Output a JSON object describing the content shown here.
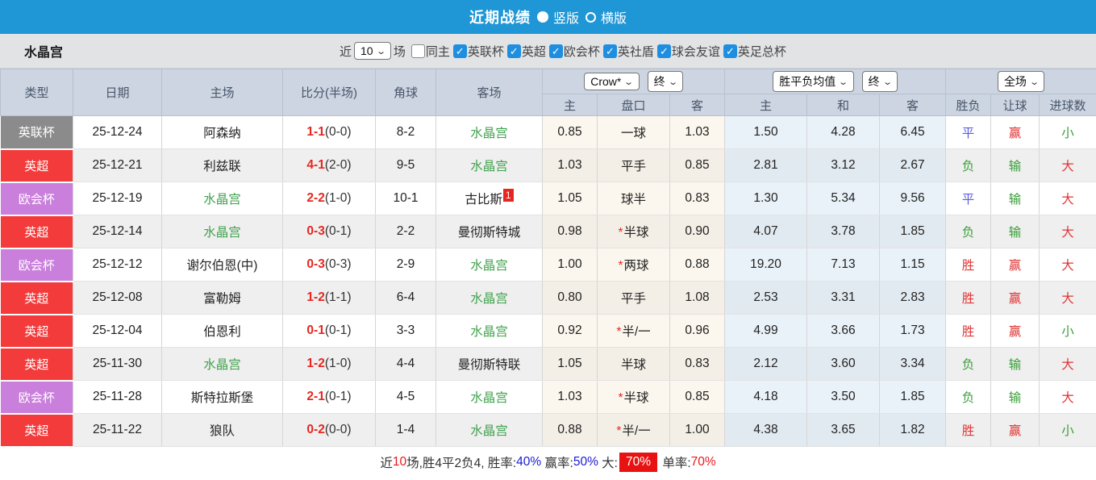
{
  "topbar": {
    "title": "近期战绩",
    "radio_vertical": "竖版",
    "radio_horizontal": "横版"
  },
  "filter": {
    "team": "水晶宫",
    "recent_label": "近",
    "recent_value": "10",
    "matches_label": "场",
    "checkboxes": [
      {
        "label": "同主",
        "checked": false
      },
      {
        "label": "英联杯",
        "checked": true
      },
      {
        "label": "英超",
        "checked": true
      },
      {
        "label": "欧会杯",
        "checked": true
      },
      {
        "label": "英社盾",
        "checked": true
      },
      {
        "label": "球会友谊",
        "checked": true
      },
      {
        "label": "英足总杯",
        "checked": true
      }
    ]
  },
  "table": {
    "columns_left": [
      "类型",
      "日期",
      "主场",
      "比分(半场)",
      "角球",
      "客场"
    ],
    "dropdowns": {
      "odds_company": "Crow*",
      "ah_time": "终",
      "wdl_source": "胜平负均值",
      "wdl_time": "终",
      "scope": "全场"
    },
    "sub_columns": [
      "主",
      "盘口",
      "客",
      "主",
      "和",
      "客",
      "胜负",
      "让球",
      "进球数"
    ],
    "rows": [
      {
        "type": "英联杯",
        "date": "25-12-24",
        "home": "阿森纳",
        "home_self": false,
        "score_ft": "1-1",
        "score_ht": "(0-0)",
        "corner": "8-2",
        "away": "水晶宫",
        "away_self": true,
        "away_sup": "",
        "ah_home": "0.85",
        "ah_line": "一球",
        "ah_away": "1.03",
        "eu_home": "1.50",
        "eu_draw": "4.28",
        "eu_away": "6.45",
        "wdl": "平",
        "handicap_res": "赢",
        "goals_res": "小"
      },
      {
        "type": "英超",
        "date": "25-12-21",
        "home": "利兹联",
        "home_self": false,
        "score_ft": "4-1",
        "score_ht": "(2-0)",
        "corner": "9-5",
        "away": "水晶宫",
        "away_self": true,
        "away_sup": "",
        "ah_home": "1.03",
        "ah_line": "平手",
        "ah_away": "0.85",
        "eu_home": "2.81",
        "eu_draw": "3.12",
        "eu_away": "2.67",
        "wdl": "负",
        "handicap_res": "输",
        "goals_res": "大"
      },
      {
        "type": "欧会杯",
        "date": "25-12-19",
        "home": "水晶宫",
        "home_self": true,
        "score_ft": "2-2",
        "score_ht": "(1-0)",
        "corner": "10-1",
        "away": "古比斯",
        "away_self": false,
        "away_sup": "1",
        "ah_home": "1.05",
        "ah_line": "球半",
        "ah_away": "0.83",
        "eu_home": "1.30",
        "eu_draw": "5.34",
        "eu_away": "9.56",
        "wdl": "平",
        "handicap_res": "输",
        "goals_res": "大"
      },
      {
        "type": "英超",
        "date": "25-12-14",
        "home": "水晶宫",
        "home_self": true,
        "score_ft": "0-3",
        "score_ht": "(0-1)",
        "corner": "2-2",
        "away": "曼彻斯特城",
        "away_self": false,
        "away_sup": "",
        "ah_home": "0.98",
        "ah_line": "*半球",
        "ah_away": "0.90",
        "eu_home": "4.07",
        "eu_draw": "3.78",
        "eu_away": "1.85",
        "wdl": "负",
        "handicap_res": "输",
        "goals_res": "大"
      },
      {
        "type": "欧会杯",
        "date": "25-12-12",
        "home": "谢尔伯恩(中)",
        "home_self": false,
        "score_ft": "0-3",
        "score_ht": "(0-3)",
        "corner": "2-9",
        "away": "水晶宫",
        "away_self": true,
        "away_sup": "",
        "ah_home": "1.00",
        "ah_line": "*两球",
        "ah_away": "0.88",
        "eu_home": "19.20",
        "eu_draw": "7.13",
        "eu_away": "1.15",
        "wdl": "胜",
        "handicap_res": "赢",
        "goals_res": "大"
      },
      {
        "type": "英超",
        "date": "25-12-08",
        "home": "富勒姆",
        "home_self": false,
        "score_ft": "1-2",
        "score_ht": "(1-1)",
        "corner": "6-4",
        "away": "水晶宫",
        "away_self": true,
        "away_sup": "",
        "ah_home": "0.80",
        "ah_line": "平手",
        "ah_away": "1.08",
        "eu_home": "2.53",
        "eu_draw": "3.31",
        "eu_away": "2.83",
        "wdl": "胜",
        "handicap_res": "赢",
        "goals_res": "大"
      },
      {
        "type": "英超",
        "date": "25-12-04",
        "home": "伯恩利",
        "home_self": false,
        "score_ft": "0-1",
        "score_ht": "(0-1)",
        "corner": "3-3",
        "away": "水晶宫",
        "away_self": true,
        "away_sup": "",
        "ah_home": "0.92",
        "ah_line": "*半/一",
        "ah_away": "0.96",
        "eu_home": "4.99",
        "eu_draw": "3.66",
        "eu_away": "1.73",
        "wdl": "胜",
        "handicap_res": "赢",
        "goals_res": "小"
      },
      {
        "type": "英超",
        "date": "25-11-30",
        "home": "水晶宫",
        "home_self": true,
        "score_ft": "1-2",
        "score_ht": "(1-0)",
        "corner": "4-4",
        "away": "曼彻斯特联",
        "away_self": false,
        "away_sup": "",
        "ah_home": "1.05",
        "ah_line": "半球",
        "ah_away": "0.83",
        "eu_home": "2.12",
        "eu_draw": "3.60",
        "eu_away": "3.34",
        "wdl": "负",
        "handicap_res": "输",
        "goals_res": "大"
      },
      {
        "type": "欧会杯",
        "date": "25-11-28",
        "home": "斯特拉斯堡",
        "home_self": false,
        "score_ft": "2-1",
        "score_ht": "(0-1)",
        "corner": "4-5",
        "away": "水晶宫",
        "away_self": true,
        "away_sup": "",
        "ah_home": "1.03",
        "ah_line": "*半球",
        "ah_away": "0.85",
        "eu_home": "4.18",
        "eu_draw": "3.50",
        "eu_away": "1.85",
        "wdl": "负",
        "handicap_res": "输",
        "goals_res": "大"
      },
      {
        "type": "英超",
        "date": "25-11-22",
        "home": "狼队",
        "home_self": false,
        "score_ft": "0-2",
        "score_ht": "(0-0)",
        "corner": "1-4",
        "away": "水晶宫",
        "away_self": true,
        "away_sup": "",
        "ah_home": "0.88",
        "ah_line": "*半/一",
        "ah_away": "1.00",
        "eu_home": "4.38",
        "eu_draw": "3.65",
        "eu_away": "1.82",
        "wdl": "胜",
        "handicap_res": "赢",
        "goals_res": "小"
      }
    ]
  },
  "league_colors": {
    "英联杯": "#8b8b8b",
    "英超": "#f43b3b",
    "欧会杯": "#c97fdb"
  },
  "result_colors": {
    "胜": "#e03333",
    "平": "#5a5ae0",
    "负": "#3a9e3a",
    "赢": "#e03333",
    "输": "#3a9e3a",
    "大": "#e03333",
    "小": "#3a9e3a"
  },
  "ui_colors": {
    "topbar_blue": "#1f96d5",
    "header_bg": "#ccd5e1",
    "filter_bg": "#e2e3e5",
    "cream_col": "#fbf7ee",
    "lightblue_col": "#e9f2f9",
    "score_red": "#e8261f",
    "self_team_green": "#3fa24c"
  },
  "footer": {
    "parts": [
      {
        "text": "近",
        "style": "dark"
      },
      {
        "text": "10",
        "style": "red"
      },
      {
        "text": "场,胜4平2负4, ",
        "style": "dark"
      },
      {
        "text": "胜率:",
        "style": "dark"
      },
      {
        "text": "40%",
        "style": "blue"
      },
      {
        "text": " 赢率:",
        "style": "dark"
      },
      {
        "text": "50%",
        "style": "blue"
      },
      {
        "text": " 大:",
        "style": "dark"
      },
      {
        "text": "70%",
        "style": "red-badge"
      },
      {
        "text": " 单率:",
        "style": "dark"
      },
      {
        "text": "70%",
        "style": "red"
      }
    ]
  }
}
